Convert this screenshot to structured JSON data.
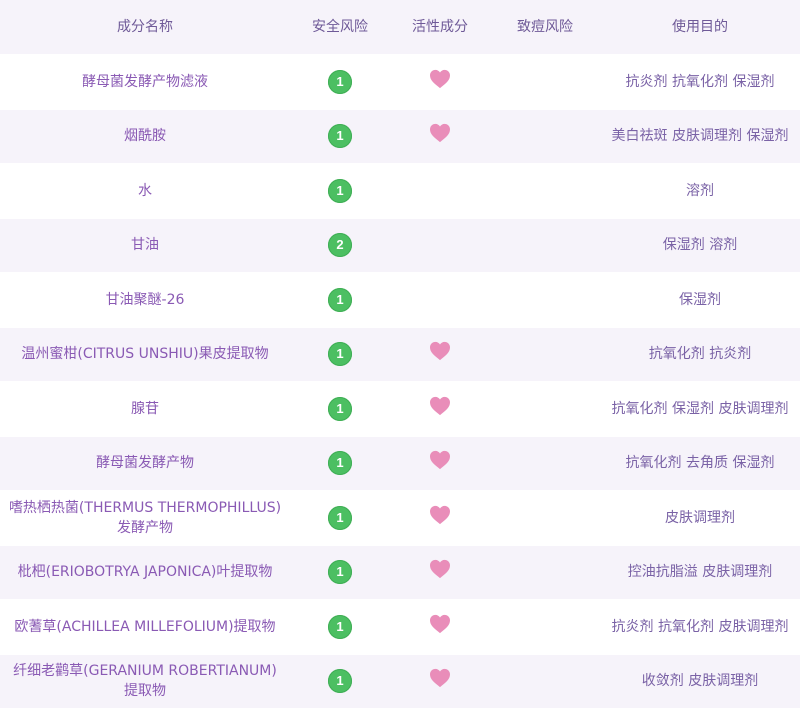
{
  "colors": {
    "badge": "#4cbf62",
    "heart": "#e98db9",
    "text": "#7a62a6",
    "stripe": "#f6f3fa"
  },
  "header": {
    "name": "成分名称",
    "safety": "安全风险",
    "active": "活性成分",
    "acne": "致痘风险",
    "purpose": "使用目的"
  },
  "rows": [
    {
      "name": "酵母菌发酵产物滤液",
      "safety": "1",
      "active": true,
      "purpose": "抗炎剂 抗氧化剂 保湿剂"
    },
    {
      "name": "烟酰胺",
      "safety": "1",
      "active": true,
      "purpose": "美白祛斑 皮肤调理剂 保湿剂"
    },
    {
      "name": "水",
      "safety": "1",
      "active": false,
      "purpose": "溶剂"
    },
    {
      "name": "甘油",
      "safety": "2",
      "active": false,
      "purpose": "保湿剂 溶剂"
    },
    {
      "name": "甘油聚醚-26",
      "safety": "1",
      "active": false,
      "purpose": "保湿剂"
    },
    {
      "name": "温州蜜柑(CITRUS UNSHIU)果皮提取物",
      "safety": "1",
      "active": true,
      "purpose": "抗氧化剂 抗炎剂"
    },
    {
      "name": "腺苷",
      "safety": "1",
      "active": true,
      "purpose": "抗氧化剂 保湿剂 皮肤调理剂"
    },
    {
      "name": "酵母菌发酵产物",
      "safety": "1",
      "active": true,
      "purpose": "抗氧化剂 去角质 保湿剂"
    },
    {
      "name": "嗜热栖热菌(THERMUS THERMOPHILLUS)发酵产物",
      "safety": "1",
      "active": true,
      "purpose": "皮肤调理剂"
    },
    {
      "name": "枇杷(ERIOBOTRYA JAPONICA)叶提取物",
      "safety": "1",
      "active": true,
      "purpose": "控油抗脂溢 皮肤调理剂"
    },
    {
      "name": "欧蓍草(ACHILLEA MILLEFOLIUM)提取物",
      "safety": "1",
      "active": true,
      "purpose": "抗炎剂 抗氧化剂 皮肤调理剂"
    },
    {
      "name": "纤细老鹳草(GERANIUM ROBERTIANUM)提取物",
      "safety": "1",
      "active": true,
      "purpose": "收敛剂 皮肤调理剂"
    }
  ]
}
